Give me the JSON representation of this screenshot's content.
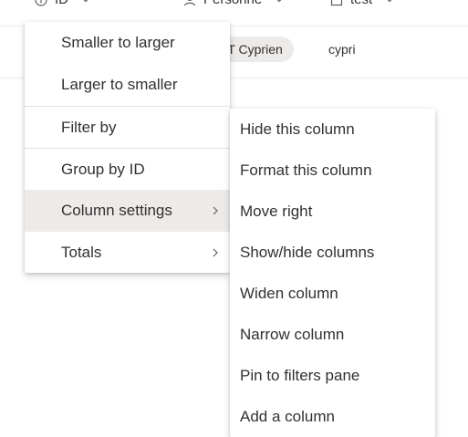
{
  "header": {
    "columns": [
      {
        "label": "ID",
        "icon": "info-icon"
      },
      {
        "label": "Personne",
        "icon": "person-icon"
      },
      {
        "label": "test",
        "icon": "calendar-icon"
      }
    ]
  },
  "row": {
    "cells": [
      "ET Cyprien",
      "cypri"
    ]
  },
  "context_menu": {
    "items": [
      {
        "label": "Smaller to larger"
      },
      {
        "label": "Larger to smaller"
      },
      {
        "label": "Filter by"
      },
      {
        "label": "Group by ID"
      },
      {
        "label": "Column settings"
      },
      {
        "label": "Totals"
      }
    ]
  },
  "submenu": {
    "items": [
      {
        "label": "Hide this column"
      },
      {
        "label": "Format this column"
      },
      {
        "label": "Move right"
      },
      {
        "label": "Show/hide columns"
      },
      {
        "label": "Widen column"
      },
      {
        "label": "Narrow column"
      },
      {
        "label": "Pin to filters pane"
      },
      {
        "label": "Add a column"
      }
    ]
  },
  "colors": {
    "active_bg": "#edebe9",
    "text": "#323130",
    "separator": "#e1dfdd"
  }
}
